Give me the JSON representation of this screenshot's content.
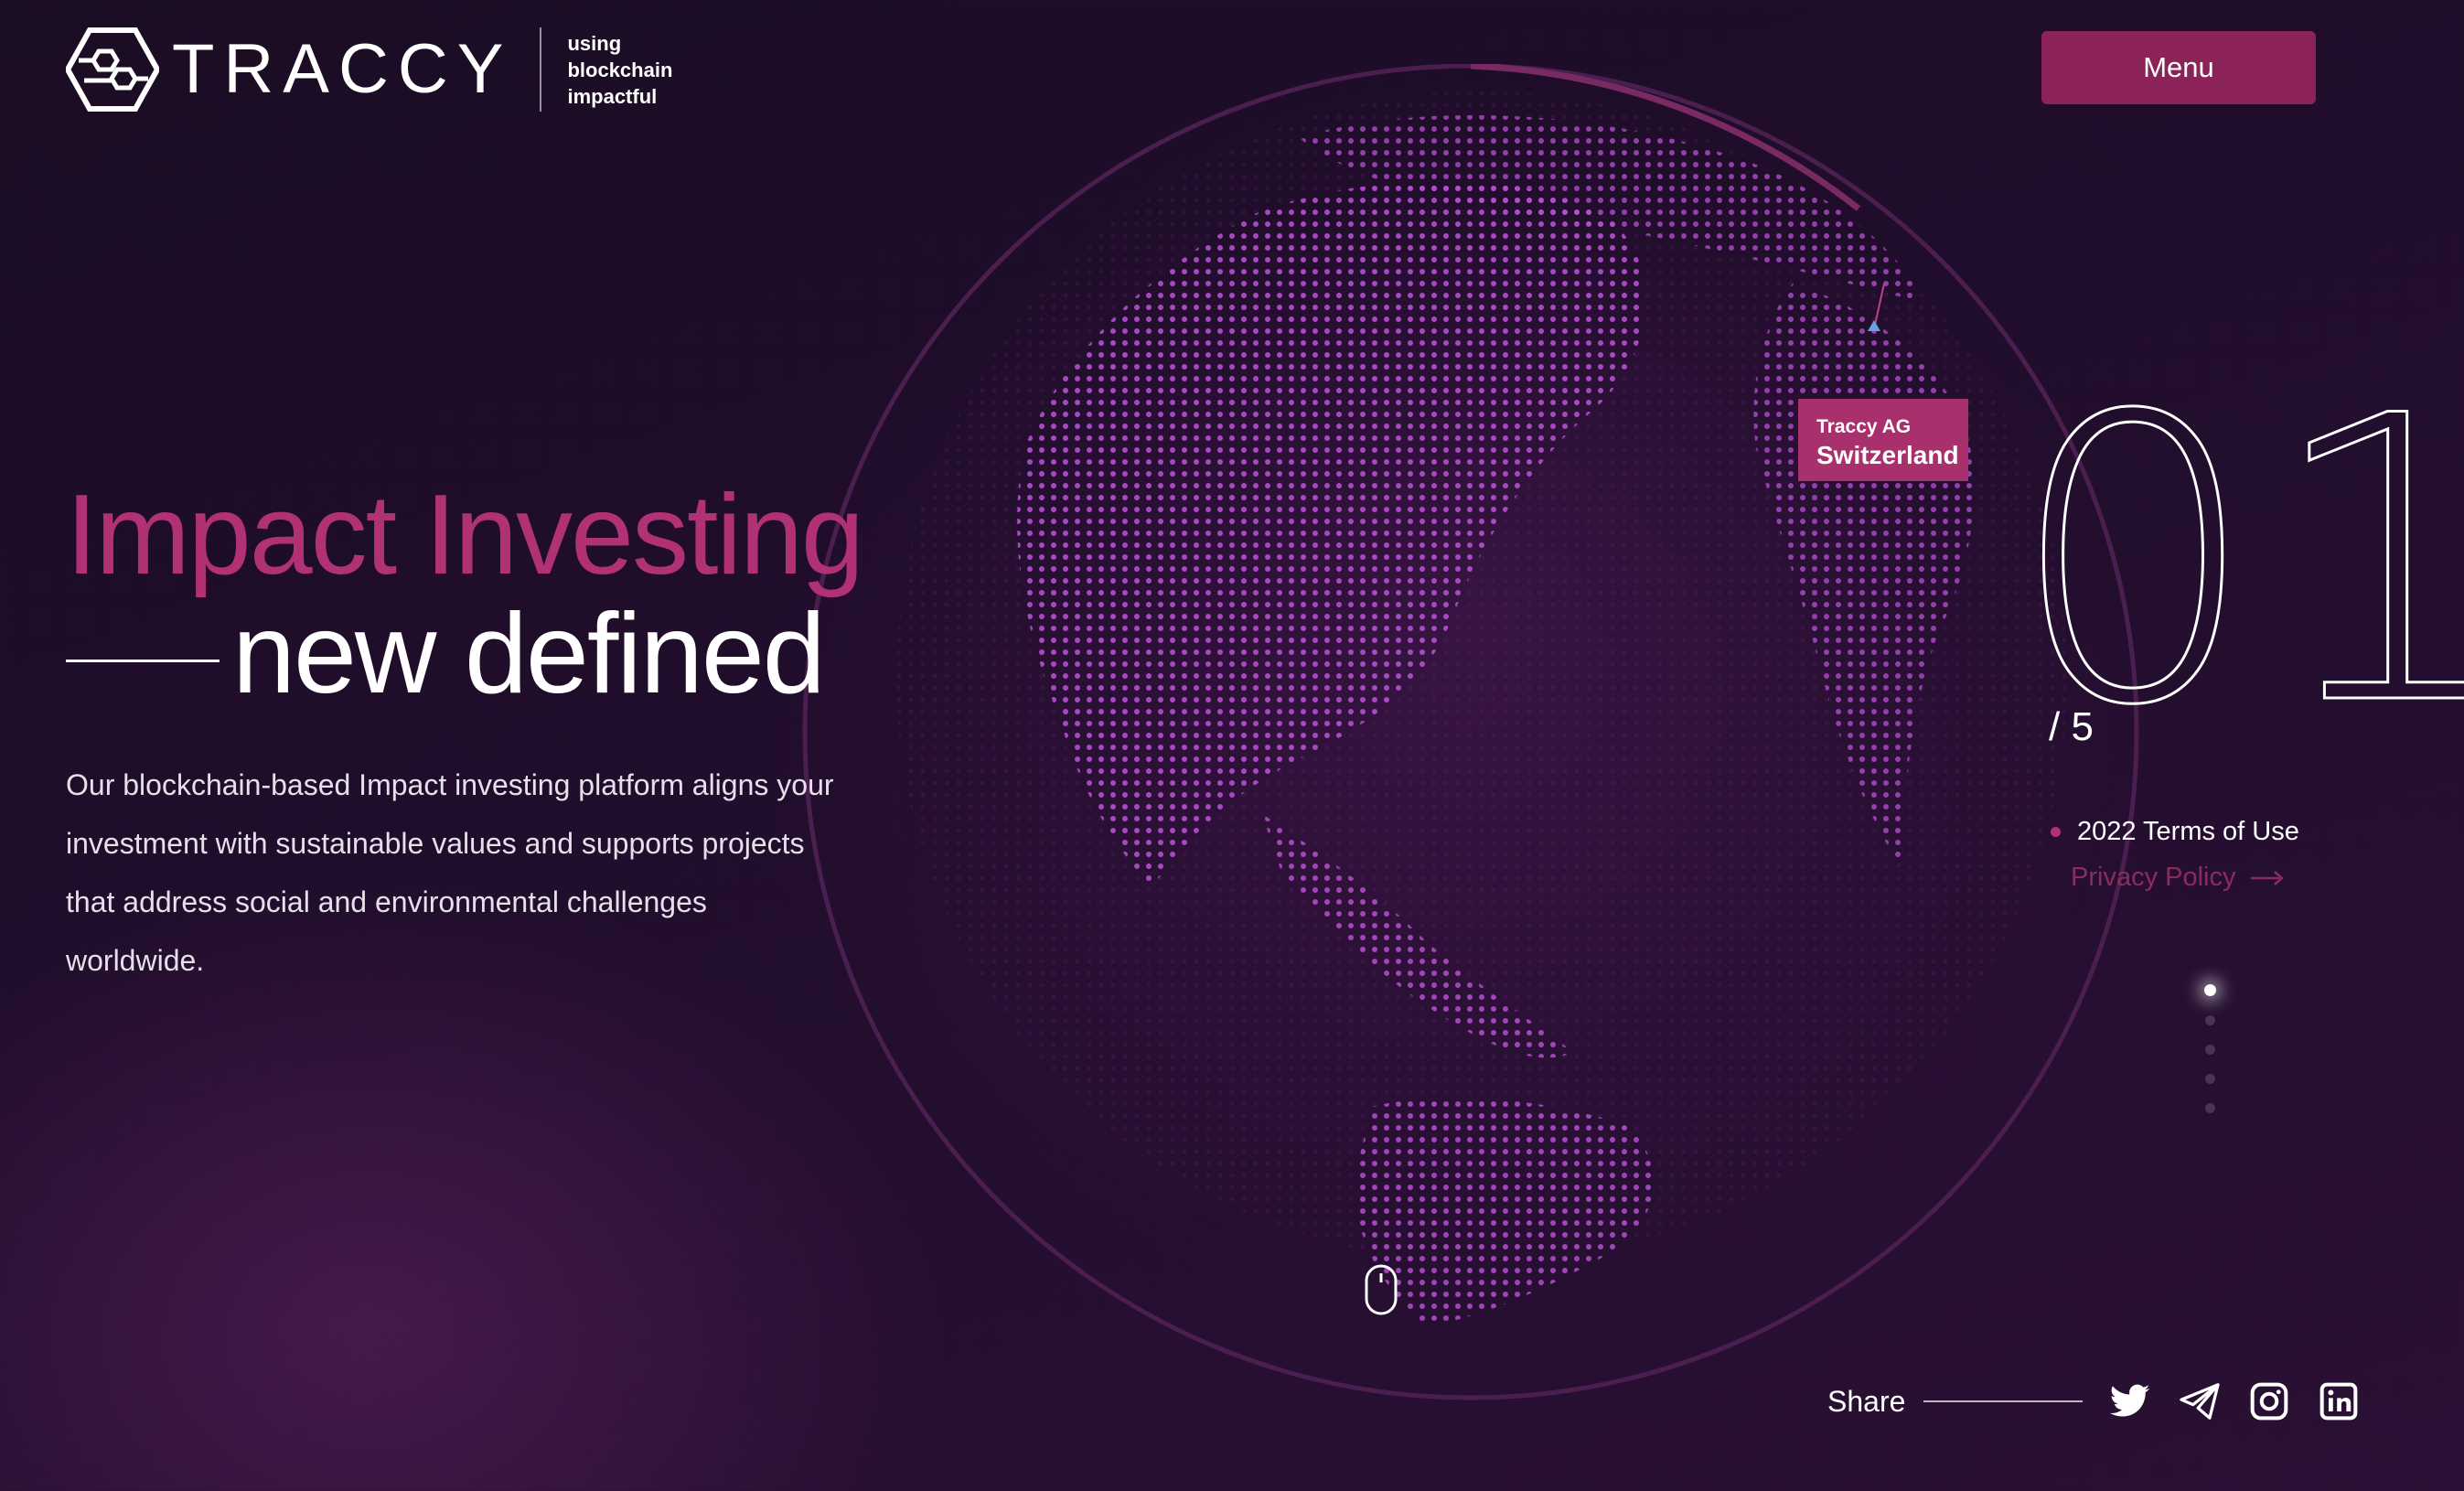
{
  "header": {
    "brand": "TRACCY",
    "tagline_lines": [
      "using",
      "blockchain",
      "impactful"
    ],
    "menu_label": "Menu"
  },
  "hero": {
    "title_line1": "Impact Investing",
    "title_line2": "new defined",
    "body": "Our blockchain-based Impact investing platform aligns your investment with sustainable values and supports projects that address social and environmental challenges worldwide."
  },
  "location_tag": {
    "company": "Traccy AG",
    "country": "Switzerland"
  },
  "slider": {
    "current": "01",
    "total": "/ 5",
    "active_index": 0,
    "count": 5
  },
  "footer_links": {
    "terms": "2022 Terms of Use",
    "privacy": "Privacy Policy"
  },
  "share": {
    "label": "Share",
    "icons": [
      "twitter-icon",
      "telegram-icon",
      "instagram-icon",
      "linkedin-icon"
    ]
  },
  "colors": {
    "accent": "#b03174",
    "button": "#8b2358",
    "background": "#1f0d29"
  }
}
